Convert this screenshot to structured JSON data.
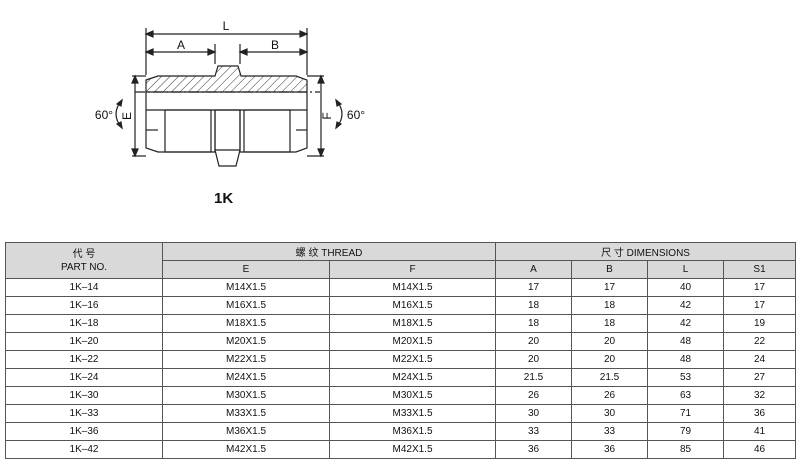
{
  "figure": {
    "model": "1K",
    "dim_L": "L",
    "dim_A": "A",
    "dim_B": "B",
    "dim_E": "E",
    "dim_F": "F",
    "angle_left": "60°",
    "angle_right": "60°"
  },
  "table": {
    "part_no_cn": "代 号",
    "part_no_en": "PART NO.",
    "thread_header": "螺 纹  THREAD",
    "dimensions_header": "尺 寸   DIMENSIONS",
    "columns": [
      "E",
      "F",
      "A",
      "B",
      "L",
      "S1"
    ],
    "rows": [
      [
        "1K–14",
        "M14X1.5",
        "M14X1.5",
        "17",
        "17",
        "40",
        "17"
      ],
      [
        "1K–16",
        "M16X1.5",
        "M16X1.5",
        "18",
        "18",
        "42",
        "17"
      ],
      [
        "1K–18",
        "M18X1.5",
        "M18X1.5",
        "18",
        "18",
        "42",
        "19"
      ],
      [
        "1K–20",
        "M20X1.5",
        "M20X1.5",
        "20",
        "20",
        "48",
        "22"
      ],
      [
        "1K–22",
        "M22X1.5",
        "M22X1.5",
        "20",
        "20",
        "48",
        "24"
      ],
      [
        "1K–24",
        "M24X1.5",
        "M24X1.5",
        "21.5",
        "21.5",
        "53",
        "27"
      ],
      [
        "1K–30",
        "M30X1.5",
        "M30X1.5",
        "26",
        "26",
        "63",
        "32"
      ],
      [
        "1K–33",
        "M33X1.5",
        "M33X1.5",
        "30",
        "30",
        "71",
        "36"
      ],
      [
        "1K–36",
        "M36X1.5",
        "M36X1.5",
        "33",
        "33",
        "79",
        "41"
      ],
      [
        "1K–42",
        "M42X1.5",
        "M42X1.5",
        "36",
        "36",
        "85",
        "46"
      ]
    ]
  }
}
